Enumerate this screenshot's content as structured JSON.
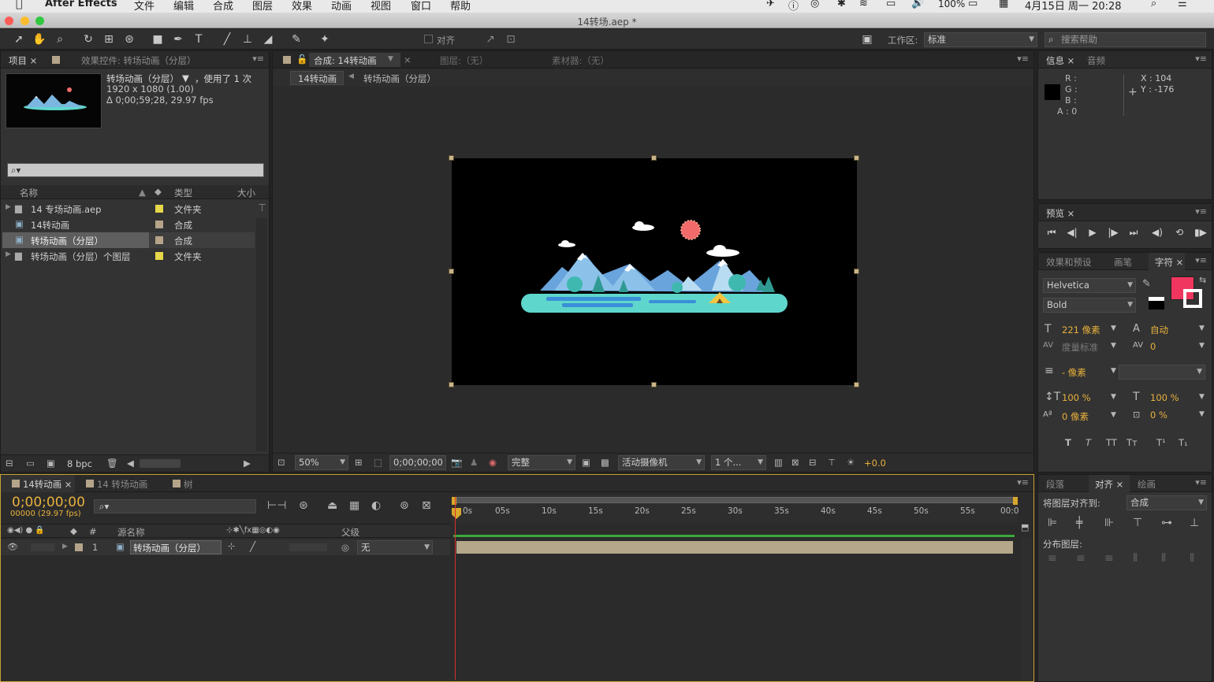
{
  "menubar": {
    "app_name": "After Effects",
    "items": [
      "文件",
      "编辑",
      "合成",
      "图层",
      "效果",
      "动画",
      "视图",
      "窗口",
      "帮助"
    ],
    "battery": "100%",
    "datetime": "4月15日 周一  20:28"
  },
  "window": {
    "title": "14转场.aep *"
  },
  "toolbar": {
    "align_label": "对齐",
    "workspace_label": "工作区:",
    "workspace_value": "标准",
    "search_placeholder": "搜索帮助"
  },
  "project_panel": {
    "tab_project": "项目",
    "tab_effects": "效果控件: 转场动画（分层）",
    "item_name": "转场动画（分层）",
    "item_usage": "，使用了 1 次",
    "item_size": "1920 x 1080 (1.00)",
    "item_duration": "Δ 0;00;59;28, 29.97 fps",
    "search_placeholder": "",
    "columns": {
      "name": "名称",
      "type": "类型",
      "size": "大小"
    },
    "rows": [
      {
        "name": "14 专场动画.aep",
        "type": "文件夹",
        "label_color": "#e6d84a"
      },
      {
        "name": "14转动画",
        "type": "合成",
        "label_color": "#b5a48a"
      },
      {
        "name": "转场动画（分层）",
        "type": "合成",
        "label_color": "#b5a48a"
      },
      {
        "name": "转场动画（分层）个图层",
        "type": "文件夹",
        "label_color": "#e6d84a"
      }
    ],
    "bpc": "8 bpc"
  },
  "composition_panel": {
    "tab_comp": "合成: 14转动画",
    "tab_layer": "图层:（无）",
    "tab_footage": "素材器:（无）",
    "crumb_1": "14转动画",
    "crumb_2": "转场动画（分层）",
    "zoom": "50%",
    "timecode": "0;00;00;00",
    "resolution": "完整",
    "camera": "活动摄像机",
    "views": "1 个...",
    "exposure": "+0.0"
  },
  "info_panel": {
    "tab_info": "信息",
    "tab_audio": "音频",
    "r": "R :",
    "g": "G :",
    "b": "B :",
    "a": "A : 0",
    "x": "X : 104",
    "y": "Y : -176"
  },
  "preview_panel": {
    "tab": "预览"
  },
  "character_panel": {
    "tab_effects": "效果和预设",
    "tab_brush": "画笔",
    "tab_char": "字符",
    "font": "Helvetica",
    "style": "Bold",
    "font_size": "221 像素",
    "leading": "自动",
    "kerning": "度量标准",
    "tracking": "0",
    "stroke": "- 像素",
    "vscale": "100 %",
    "hscale": "100 %",
    "baseline": "0 像素",
    "tsume": "0 %",
    "fill_color": "#f0365e",
    "style_buttons": [
      "T",
      "T",
      "TT",
      "Tт",
      "T¹",
      "T₁"
    ]
  },
  "timeline_panel": {
    "tab_1": "14转动画",
    "tab_2": "14 转场动画",
    "tab_3": "树",
    "timecode": "0;00;00;00",
    "frame_info": "00000 (29.97 fps)",
    "col_name": "源名称",
    "col_parent": "父级",
    "ticks": [
      "0s",
      "05s",
      "10s",
      "15s",
      "20s",
      "25s",
      "30s",
      "35s",
      "40s",
      "45s",
      "50s",
      "55s",
      "00:0"
    ],
    "layer": {
      "index": "1",
      "name": "转场动画（分层）",
      "parent": "无"
    }
  },
  "align_panel": {
    "tab_para": "段落",
    "tab_align": "对齐",
    "tab_paint": "绘画",
    "align_to_label": "将图层对齐到:",
    "align_to_value": "合成",
    "distribute_label": "分布图层:"
  }
}
